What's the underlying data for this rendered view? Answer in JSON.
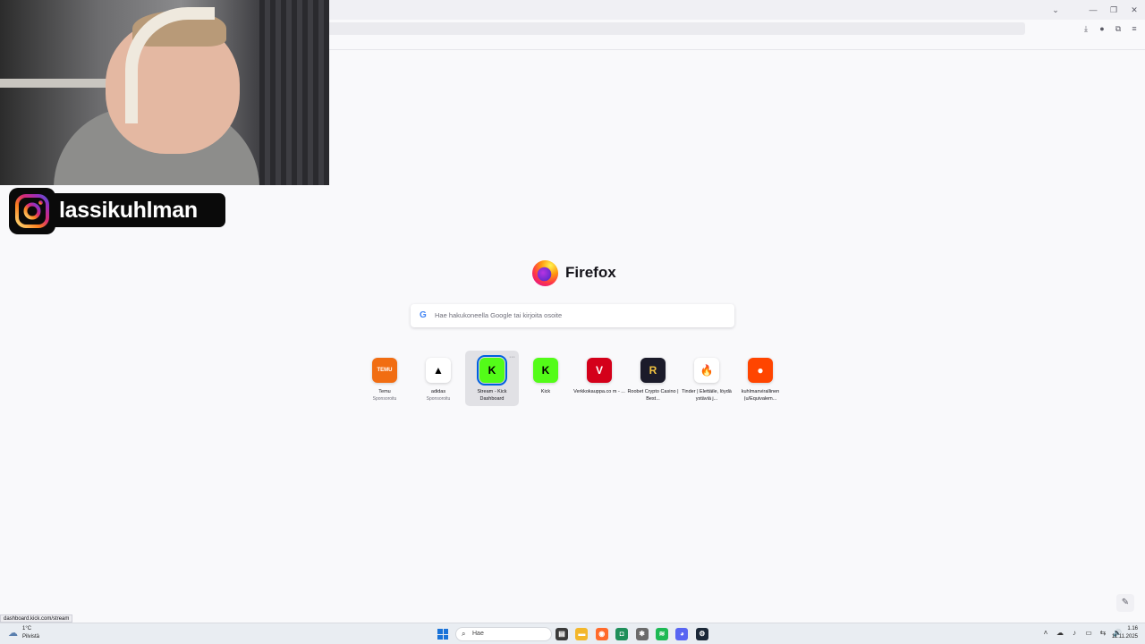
{
  "browser": {
    "window_controls": {
      "tabs_list_glyph": "⌄",
      "minimize_glyph": "—",
      "restore_glyph": "❐",
      "close_glyph": "✕"
    },
    "toolbar_icons": [
      "download-icon",
      "account-icon",
      "extensions-icon",
      "menu-icon"
    ],
    "toolbar_glyphs": {
      "download": "⤓",
      "account": "●",
      "extensions": "⧉",
      "menu": "≡"
    }
  },
  "overlay": {
    "instagram_handle": "lassikuhlman"
  },
  "newtab": {
    "brand": "Firefox",
    "search": {
      "google_glyph": "G",
      "placeholder": "Hae hakukoneella Google tai kirjoita osoite"
    },
    "shortcuts": [
      {
        "label": "Temu",
        "sublabel": "Sponsoroitu",
        "icon": "temu-icon",
        "glyph": "TEMU",
        "bg": "#f16d12",
        "fg": "#ffffff"
      },
      {
        "label": "adidas",
        "sublabel": "Sponsoroitu",
        "icon": "adidas-icon",
        "glyph": "▲",
        "bg": "#ffffff",
        "fg": "#000000"
      },
      {
        "label": "Stream - Kick Dashboard",
        "sublabel": "",
        "icon": "kick-icon",
        "glyph": "K",
        "bg": "#53fc18",
        "fg": "#000000",
        "hover": true
      },
      {
        "label": "Kick",
        "sublabel": "",
        "icon": "kick-icon",
        "glyph": "K",
        "bg": "#53fc18",
        "fg": "#000000"
      },
      {
        "label": "Verkkokauppa.co m - ...",
        "sublabel": "",
        "icon": "verkkokauppa-icon",
        "glyph": "V",
        "bg": "#d4001a",
        "fg": "#ffffff"
      },
      {
        "label": "Roobet Crypto Casino | Best...",
        "sublabel": "",
        "icon": "roobet-icon",
        "glyph": "R",
        "bg": "#1b1b2a",
        "fg": "#f2c341"
      },
      {
        "label": "Tinder | Elettäile, löydä ystäviä j...",
        "sublabel": "",
        "icon": "tinder-icon",
        "glyph": "🔥",
        "bg": "#ffffff",
        "fg": "#fd5068"
      },
      {
        "label": "kuhlmanvirallinen (u/Equivalem...",
        "sublabel": "",
        "icon": "reddit-icon",
        "glyph": "●",
        "bg": "#ff4500",
        "fg": "#ffffff"
      }
    ],
    "more_glyph": "···",
    "edit_glyph": "✎"
  },
  "status_bar": {
    "hover_url": "dashboard.kick.com/stream"
  },
  "taskbar": {
    "weather": {
      "temp": "1°C",
      "desc": "Pilvistä",
      "glyph": "☁"
    },
    "search_label": "Hae",
    "search_glyph": "⌕",
    "apps": [
      {
        "name": "files-app-icon",
        "glyph": "▤",
        "color": "#3a3a3a"
      },
      {
        "name": "file-explorer-icon",
        "glyph": "▬",
        "color": "#f3b72b"
      },
      {
        "name": "firefox-taskbar-icon",
        "glyph": "◉",
        "color": "#ff6a2b"
      },
      {
        "name": "app-green-icon",
        "glyph": "◘",
        "color": "#1f8f5a"
      },
      {
        "name": "app-puzzle-icon",
        "glyph": "✱",
        "color": "#6b6b6b"
      },
      {
        "name": "spotify-icon",
        "glyph": "≋",
        "color": "#1db954"
      },
      {
        "name": "discord-icon",
        "glyph": "◕",
        "color": "#5865f2"
      },
      {
        "name": "steam-icon",
        "glyph": "⚙",
        "color": "#1b2838"
      }
    ],
    "tray_glyphs": [
      "˄",
      "☁",
      "♪",
      "▭",
      "⇆",
      "🔊"
    ],
    "time": "1.16",
    "date": "11.11.2025"
  }
}
